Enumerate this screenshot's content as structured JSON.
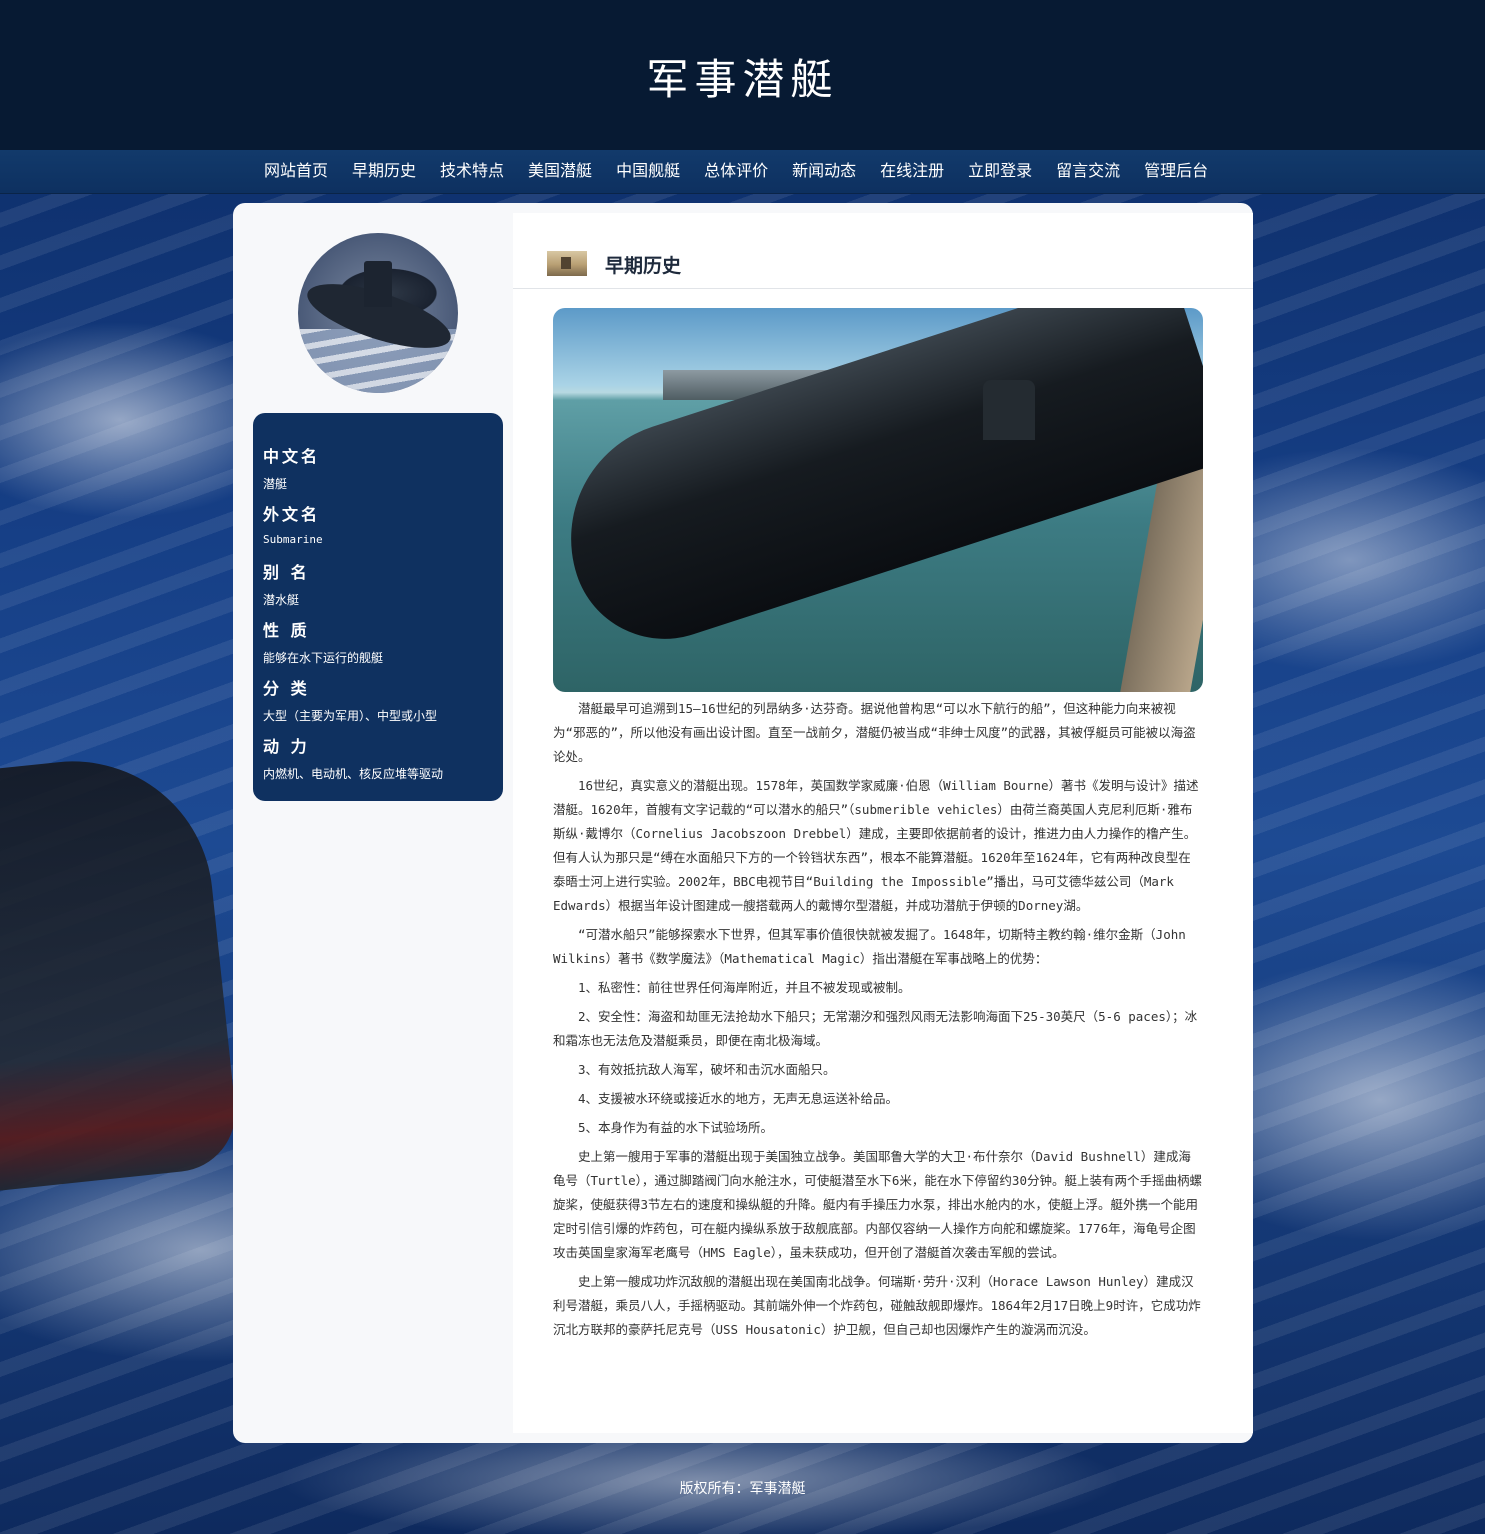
{
  "header": {
    "site_title": "军事潜艇"
  },
  "nav": {
    "items": [
      "网站首页",
      "早期历史",
      "技术特点",
      "美国潜艇",
      "中国舰艇",
      "总体评价",
      "新闻动态",
      "在线注册",
      "立即登录",
      "留言交流",
      "管理后台"
    ]
  },
  "sidebar": {
    "info": [
      {
        "term": "中文名",
        "value": "潜艇"
      },
      {
        "term": "外文名",
        "value": "Submarine"
      },
      {
        "term": "别 名",
        "value": "潜水艇"
      },
      {
        "term": "性 质",
        "value": "能够在水下运行的舰艇"
      },
      {
        "term": "分 类",
        "value": "大型（主要为军用）、中型或小型"
      },
      {
        "term": "动 力",
        "value": "内燃机、电动机、核反应堆等驱动"
      }
    ]
  },
  "main": {
    "section_title": "早期历史",
    "paragraphs": [
      "潜艇最早可追溯到15—16世纪的列昂纳多·达芬奇。据说他曾构思“可以水下航行的船”，但这种能力向来被视为“邪恶的”，所以他没有画出设计图。直至一战前夕，潜艇仍被当成“非绅士风度”的武器，其被俘艇员可能被以海盗论处。",
      "16世纪，真实意义的潜艇出现。1578年，英国数学家威廉·伯恩（William Bourne）著书《发明与设计》描述潜艇。1620年，首艘有文字记载的“可以潜水的船只”（submerible vehicles）由荷兰裔英国人克尼利厄斯·雅布斯纵·戴博尔（Cornelius Jacobszoon Drebbel）建成，主要即依据前者的设计，推进力由人力操作的橹产生。但有人认为那只是“缚在水面船只下方的一个铃铛状东西”，根本不能算潜艇。1620年至1624年，它有两种改良型在泰晤士河上进行实验。2002年，BBC电视节目“Building the Impossible”播出，马可艾德华兹公司（Mark Edwards）根据当年设计图建成一艘搭载两人的戴博尔型潜艇，并成功潜航于伊顿的Dorney湖。",
      "“可潜水船只”能够探索水下世界，但其军事价值很快就被发掘了。1648年，切斯特主教约翰·维尔金斯（John Wilkins）著书《数学魔法》（Mathematical Magic）指出潜艇在军事战略上的优势：",
      "1、私密性：前往世界任何海岸附近，并且不被发现或被制。",
      "2、安全性：海盗和劫匪无法抢劫水下船只；无常潮汐和强烈风雨无法影响海面下25-30英尺（5-6 paces）；冰和霜冻也无法危及潜艇乘员，即便在南北极海域。",
      "3、有效抵抗敌人海军，破坏和击沉水面船只。",
      "4、支援被水环绕或接近水的地方，无声无息运送补给品。",
      "5、本身作为有益的水下试验场所。",
      "史上第一艘用于军事的潜艇出现于美国独立战争。美国耶鲁大学的大卫·布什奈尔（David Bushnell）建成海龟号（Turtle），通过脚踏阀门向水舱注水，可使艇潜至水下6米，能在水下停留约30分钟。艇上装有两个手摇曲柄螺旋桨，使艇获得3节左右的速度和操纵艇的升降。艇内有手操压力水泵，排出水舱内的水，使艇上浮。艇外携一个能用定时引信引爆的炸药包，可在艇内操纵系放于敌舰底部。内部仅容纳一人操作方向舵和螺旋桨。1776年，海龟号企图攻击英国皇家海军老鹰号（HMS Eagle），虽未获成功，但开创了潜艇首次袭击军舰的尝试。",
      "史上第一艘成功炸沉敌舰的潜艇出现在美国南北战争。何瑞斯·劳升·汉利（Horace Lawson Hunley）建成汉利号潜艇，乘员八人，手摇柄驱动。其前端外伸一个炸药包，碰触敌舰即爆炸。1864年2月17日晚上9时许，它成功炸沉北方联邦的豪萨托尼克号（USS Housatonic）护卫舰，但自己却也因爆炸产生的漩涡而沉没。"
    ]
  },
  "footer": {
    "copyright": "版权所有：军事潜艇"
  }
}
